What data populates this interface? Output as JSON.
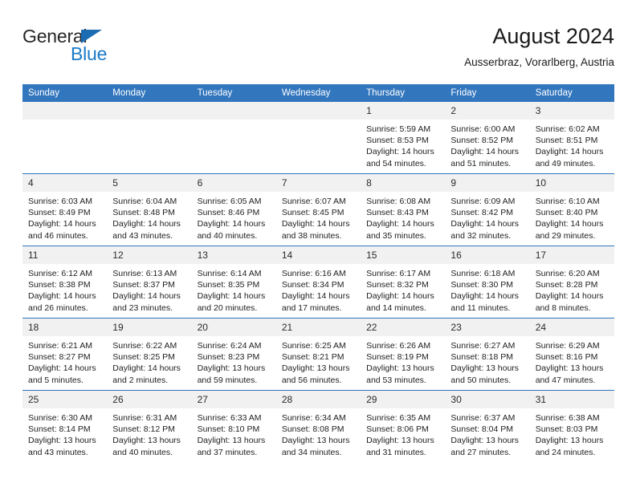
{
  "brand": {
    "name_part1": "General",
    "name_part2": "Blue",
    "triangle_icon": "triangle-icon",
    "colors": {
      "dark": "#262626",
      "blue": "#1b7ac7",
      "triangle": "#1b6cb3"
    }
  },
  "header": {
    "title": "August 2024",
    "subtitle": "Ausserbraz, Vorarlberg, Austria"
  },
  "theme": {
    "header_blue": "#3276bd",
    "daynum_bg": "#f1f1f1",
    "text": "#1e1e1e"
  },
  "calendar": {
    "weekday_headers": [
      "Sunday",
      "Monday",
      "Tuesday",
      "Wednesday",
      "Thursday",
      "Friday",
      "Saturday"
    ],
    "weeks": [
      [
        {
          "day": "",
          "sunrise": "",
          "sunset": "",
          "daylight_a": "",
          "daylight_b": "",
          "empty": true
        },
        {
          "day": "",
          "sunrise": "",
          "sunset": "",
          "daylight_a": "",
          "daylight_b": "",
          "empty": true
        },
        {
          "day": "",
          "sunrise": "",
          "sunset": "",
          "daylight_a": "",
          "daylight_b": "",
          "empty": true
        },
        {
          "day": "",
          "sunrise": "",
          "sunset": "",
          "daylight_a": "",
          "daylight_b": "",
          "empty": true
        },
        {
          "day": "1",
          "sunrise": "Sunrise: 5:59 AM",
          "sunset": "Sunset: 8:53 PM",
          "daylight_a": "Daylight: 14 hours",
          "daylight_b": "and 54 minutes."
        },
        {
          "day": "2",
          "sunrise": "Sunrise: 6:00 AM",
          "sunset": "Sunset: 8:52 PM",
          "daylight_a": "Daylight: 14 hours",
          "daylight_b": "and 51 minutes."
        },
        {
          "day": "3",
          "sunrise": "Sunrise: 6:02 AM",
          "sunset": "Sunset: 8:51 PM",
          "daylight_a": "Daylight: 14 hours",
          "daylight_b": "and 49 minutes."
        }
      ],
      [
        {
          "day": "4",
          "sunrise": "Sunrise: 6:03 AM",
          "sunset": "Sunset: 8:49 PM",
          "daylight_a": "Daylight: 14 hours",
          "daylight_b": "and 46 minutes."
        },
        {
          "day": "5",
          "sunrise": "Sunrise: 6:04 AM",
          "sunset": "Sunset: 8:48 PM",
          "daylight_a": "Daylight: 14 hours",
          "daylight_b": "and 43 minutes."
        },
        {
          "day": "6",
          "sunrise": "Sunrise: 6:05 AM",
          "sunset": "Sunset: 8:46 PM",
          "daylight_a": "Daylight: 14 hours",
          "daylight_b": "and 40 minutes."
        },
        {
          "day": "7",
          "sunrise": "Sunrise: 6:07 AM",
          "sunset": "Sunset: 8:45 PM",
          "daylight_a": "Daylight: 14 hours",
          "daylight_b": "and 38 minutes."
        },
        {
          "day": "8",
          "sunrise": "Sunrise: 6:08 AM",
          "sunset": "Sunset: 8:43 PM",
          "daylight_a": "Daylight: 14 hours",
          "daylight_b": "and 35 minutes."
        },
        {
          "day": "9",
          "sunrise": "Sunrise: 6:09 AM",
          "sunset": "Sunset: 8:42 PM",
          "daylight_a": "Daylight: 14 hours",
          "daylight_b": "and 32 minutes."
        },
        {
          "day": "10",
          "sunrise": "Sunrise: 6:10 AM",
          "sunset": "Sunset: 8:40 PM",
          "daylight_a": "Daylight: 14 hours",
          "daylight_b": "and 29 minutes."
        }
      ],
      [
        {
          "day": "11",
          "sunrise": "Sunrise: 6:12 AM",
          "sunset": "Sunset: 8:38 PM",
          "daylight_a": "Daylight: 14 hours",
          "daylight_b": "and 26 minutes."
        },
        {
          "day": "12",
          "sunrise": "Sunrise: 6:13 AM",
          "sunset": "Sunset: 8:37 PM",
          "daylight_a": "Daylight: 14 hours",
          "daylight_b": "and 23 minutes."
        },
        {
          "day": "13",
          "sunrise": "Sunrise: 6:14 AM",
          "sunset": "Sunset: 8:35 PM",
          "daylight_a": "Daylight: 14 hours",
          "daylight_b": "and 20 minutes."
        },
        {
          "day": "14",
          "sunrise": "Sunrise: 6:16 AM",
          "sunset": "Sunset: 8:34 PM",
          "daylight_a": "Daylight: 14 hours",
          "daylight_b": "and 17 minutes."
        },
        {
          "day": "15",
          "sunrise": "Sunrise: 6:17 AM",
          "sunset": "Sunset: 8:32 PM",
          "daylight_a": "Daylight: 14 hours",
          "daylight_b": "and 14 minutes."
        },
        {
          "day": "16",
          "sunrise": "Sunrise: 6:18 AM",
          "sunset": "Sunset: 8:30 PM",
          "daylight_a": "Daylight: 14 hours",
          "daylight_b": "and 11 minutes."
        },
        {
          "day": "17",
          "sunrise": "Sunrise: 6:20 AM",
          "sunset": "Sunset: 8:28 PM",
          "daylight_a": "Daylight: 14 hours",
          "daylight_b": "and 8 minutes."
        }
      ],
      [
        {
          "day": "18",
          "sunrise": "Sunrise: 6:21 AM",
          "sunset": "Sunset: 8:27 PM",
          "daylight_a": "Daylight: 14 hours",
          "daylight_b": "and 5 minutes."
        },
        {
          "day": "19",
          "sunrise": "Sunrise: 6:22 AM",
          "sunset": "Sunset: 8:25 PM",
          "daylight_a": "Daylight: 14 hours",
          "daylight_b": "and 2 minutes."
        },
        {
          "day": "20",
          "sunrise": "Sunrise: 6:24 AM",
          "sunset": "Sunset: 8:23 PM",
          "daylight_a": "Daylight: 13 hours",
          "daylight_b": "and 59 minutes."
        },
        {
          "day": "21",
          "sunrise": "Sunrise: 6:25 AM",
          "sunset": "Sunset: 8:21 PM",
          "daylight_a": "Daylight: 13 hours",
          "daylight_b": "and 56 minutes."
        },
        {
          "day": "22",
          "sunrise": "Sunrise: 6:26 AM",
          "sunset": "Sunset: 8:19 PM",
          "daylight_a": "Daylight: 13 hours",
          "daylight_b": "and 53 minutes."
        },
        {
          "day": "23",
          "sunrise": "Sunrise: 6:27 AM",
          "sunset": "Sunset: 8:18 PM",
          "daylight_a": "Daylight: 13 hours",
          "daylight_b": "and 50 minutes."
        },
        {
          "day": "24",
          "sunrise": "Sunrise: 6:29 AM",
          "sunset": "Sunset: 8:16 PM",
          "daylight_a": "Daylight: 13 hours",
          "daylight_b": "and 47 minutes."
        }
      ],
      [
        {
          "day": "25",
          "sunrise": "Sunrise: 6:30 AM",
          "sunset": "Sunset: 8:14 PM",
          "daylight_a": "Daylight: 13 hours",
          "daylight_b": "and 43 minutes."
        },
        {
          "day": "26",
          "sunrise": "Sunrise: 6:31 AM",
          "sunset": "Sunset: 8:12 PM",
          "daylight_a": "Daylight: 13 hours",
          "daylight_b": "and 40 minutes."
        },
        {
          "day": "27",
          "sunrise": "Sunrise: 6:33 AM",
          "sunset": "Sunset: 8:10 PM",
          "daylight_a": "Daylight: 13 hours",
          "daylight_b": "and 37 minutes."
        },
        {
          "day": "28",
          "sunrise": "Sunrise: 6:34 AM",
          "sunset": "Sunset: 8:08 PM",
          "daylight_a": "Daylight: 13 hours",
          "daylight_b": "and 34 minutes."
        },
        {
          "day": "29",
          "sunrise": "Sunrise: 6:35 AM",
          "sunset": "Sunset: 8:06 PM",
          "daylight_a": "Daylight: 13 hours",
          "daylight_b": "and 31 minutes."
        },
        {
          "day": "30",
          "sunrise": "Sunrise: 6:37 AM",
          "sunset": "Sunset: 8:04 PM",
          "daylight_a": "Daylight: 13 hours",
          "daylight_b": "and 27 minutes."
        },
        {
          "day": "31",
          "sunrise": "Sunrise: 6:38 AM",
          "sunset": "Sunset: 8:03 PM",
          "daylight_a": "Daylight: 13 hours",
          "daylight_b": "and 24 minutes."
        }
      ]
    ]
  }
}
